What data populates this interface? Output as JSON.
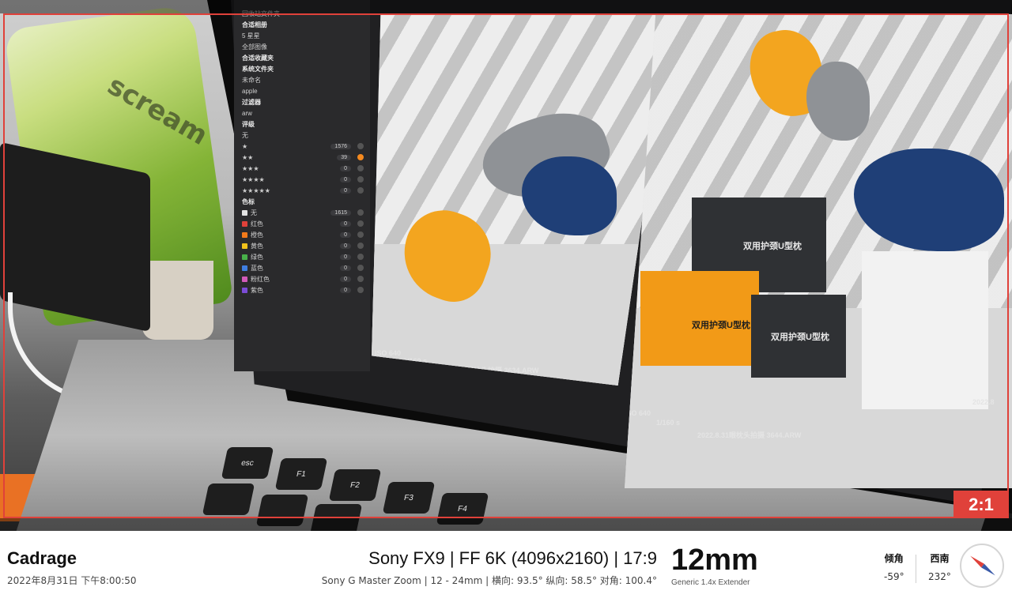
{
  "viewfinder": {
    "aspect_ratio": "2:1",
    "accent_color": "#e0413a"
  },
  "screen": {
    "sidebar": {
      "rows": [
        "回收站文件夹",
        "合适相册",
        "5 星星",
        "全部图像",
        "合适收藏夹",
        "系统文件夹",
        "未命名",
        "apple",
        "过滤器",
        "arw",
        "评级",
        "无",
        "★",
        "★★",
        "★★★",
        "★★★★",
        "★★★★★",
        "色标",
        "无",
        "红色",
        "橙色",
        "黄色",
        "绿色",
        "蓝色",
        "粉红色",
        "紫色"
      ],
      "rating_counts": [
        "",
        "1576",
        "39",
        "0",
        "0",
        "0"
      ],
      "color_counts": [
        "1615",
        "0",
        "0",
        "0",
        "0",
        "0",
        "0",
        "0"
      ],
      "color_swatches": [
        "#e2e2e2",
        "#e0413a",
        "#f27a1a",
        "#f1c21b",
        "#48b04a",
        "#3f7ee0",
        "#d15ab8",
        "#7b4cd6"
      ]
    },
    "left_photo": {
      "iso": "ISO 640",
      "shutter": "1/160 s",
      "filename": "2022.8.31眼枕头拍摄 3634.ARW"
    },
    "right_photo": {
      "iso": "ISO 640",
      "shutter": "1/160 s",
      "filename": "2022.8.31眼枕头拍摄 3644.ARW",
      "edge_date": "2022.8",
      "box_texts": [
        "双用护颈U型枕",
        "双用护颈U型枕",
        "双用护颈U型枕"
      ]
    },
    "keys": [
      "esc",
      "F1",
      "F2",
      "F3",
      "F4"
    ],
    "bottle_text": "scream"
  },
  "infobar": {
    "app_name": "Cadrage",
    "datetime": "2022年8月31日 下午8:00:50",
    "camera_line": "Sony FX9  |  FF 6K (4096x2160)  |  17:9",
    "lens_line": "Sony G Master Zoom  |  12 - 24mm  |  横向: 93.5°  纵向: 58.5°  对角: 100.4°",
    "focal_length": "12mm",
    "extender": "Generic 1.4x Extender",
    "tilt_label": "倾角",
    "tilt_value": "-59°",
    "heading_label": "西南",
    "heading_value": "232°"
  }
}
